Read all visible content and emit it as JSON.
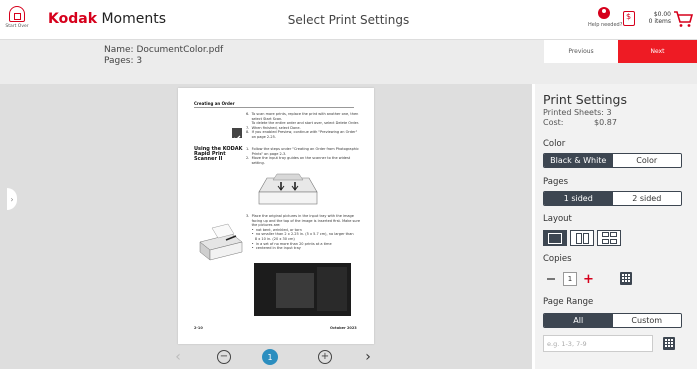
{
  "header": {
    "start_over": "Start Over",
    "brand_bold": "Kodak",
    "brand_rest": " Moments",
    "title": "Select Print Settings",
    "help": "Help needed?",
    "cart_amount": "$0.00",
    "cart_items": "0 items"
  },
  "document": {
    "name": "Name: DocumentColor.pdf",
    "pages": "Pages: 3"
  },
  "nav": {
    "previous": "Previous",
    "next": "Next"
  },
  "preview": {
    "page_heading": "Creating an Order",
    "section_heading": "Using the KODAK Rapid Print Scanner II",
    "footer_left": "2-10",
    "footer_right": "October 2023",
    "current_page": "1",
    "step_lines": [
      "6.  To scan more prints, replace the print with another one, then",
      "     select Start Scan.",
      "     To delete the entire order and start over, select Delete Order.",
      "7.  When finished, select Done.",
      "8.  If you enabled Preview, continue with \"Previewing an Order\"",
      "     on page 2-25."
    ],
    "section_lines": [
      "1.  Follow the steps under \"Creating an Order from Photographic",
      "     Prints\" on page 2-3.",
      "2.  Move the input tray guides on the scanner to the widest",
      "     setting."
    ],
    "step3_lines": [
      "3.  Place the original pictures in the input tray with the image",
      "     facing up and the top of the image is inserted first. Make sure",
      "     the pictures are:",
      "     •  not bent, wrinkled, or torn",
      "     •  no smaller than 2 x 2.25 in. (5 x 5.7 cm), no larger than",
      "        8 x 10 in. (20 x 30 cm)",
      "     •  in a set of no more than 20 prints at a time",
      "     •  centered in the input tray"
    ]
  },
  "settings": {
    "title": "Print Settings",
    "printed_sheets": "Printed Sheets: 3",
    "cost_label": "Cost:",
    "cost_value": "$0.87",
    "color_label": "Color",
    "color_options": [
      "Black & White",
      "Color"
    ],
    "color_selected": "Black & White",
    "pages_label": "Pages",
    "pages_options": [
      "1 sided",
      "2 sided"
    ],
    "pages_selected": "1 sided",
    "layout_label": "Layout",
    "copies_label": "Copies",
    "copies_value": "1",
    "range_label": "Page Range",
    "range_options": [
      "All",
      "Custom"
    ],
    "range_selected": "All",
    "range_placeholder": "e.g. 1-3, 7-9"
  },
  "colors": {
    "brand_red": "#d6001c",
    "next_red": "#ee1b24",
    "segment_dark": "#3d4651",
    "page_badge": "#2c8ebf"
  },
  "icons": [
    "home-icon",
    "help-icon",
    "receipt-icon",
    "cart-icon",
    "zoom-out-icon",
    "zoom-in-icon",
    "chevron-left-icon",
    "chevron-right-icon",
    "keypad-icon"
  ]
}
